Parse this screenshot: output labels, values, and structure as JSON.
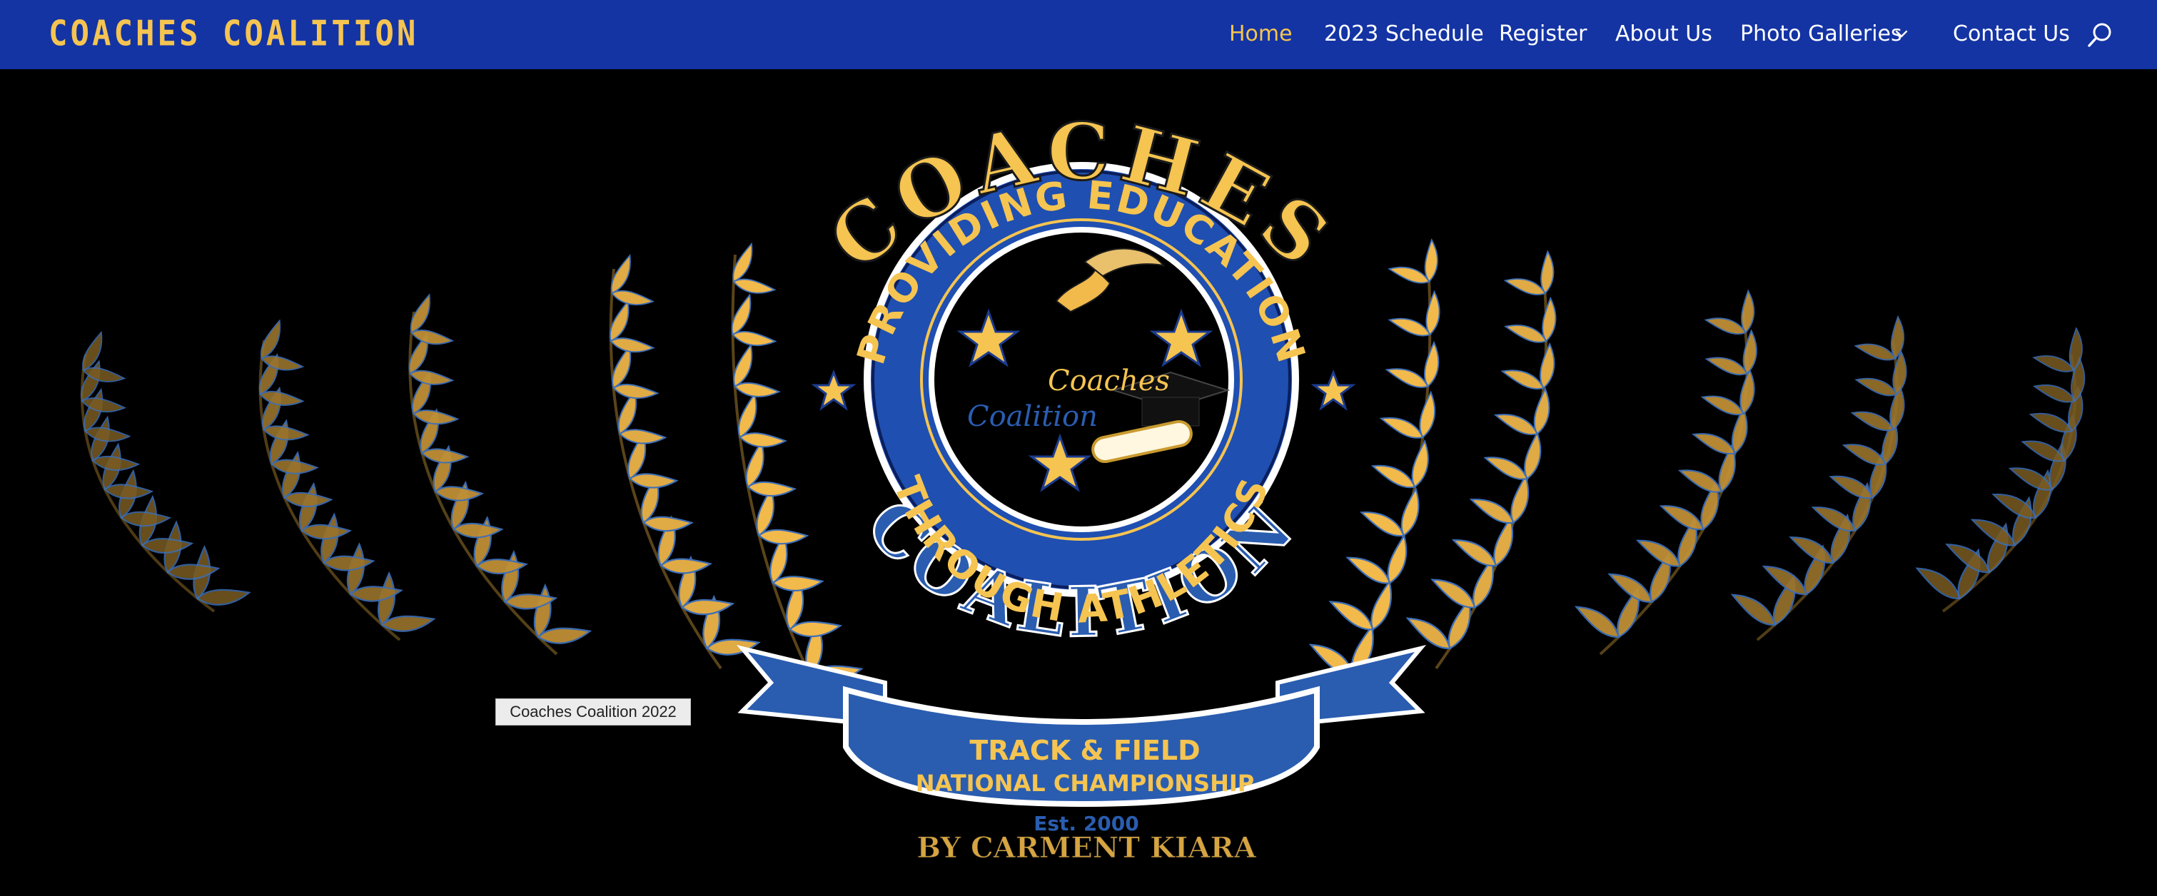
{
  "header": {
    "brand": "COACHES COALITION",
    "nav": [
      {
        "label": "Home",
        "active": true
      },
      {
        "label": "2023 Schedule"
      },
      {
        "label": "Register"
      },
      {
        "label": "About Us"
      },
      {
        "label": "Photo Galleries",
        "has_dropdown": true
      },
      {
        "label": "Contact Us"
      }
    ],
    "search_icon": "search-icon"
  },
  "emblem": {
    "arc_top": "COACHES",
    "arc_bottom": "COALITION",
    "ring_top": "PROVIDING EDUCATION",
    "ring_bottom": "THROUGH ATHLETICS",
    "center_line1": "Coaches",
    "center_line2": "Coalition",
    "banner_line1": "TRACK & FIELD",
    "banner_line2": "NATIONAL CHAMPIONSHIP",
    "est": "Est. 2000",
    "credit": "BY CARMENT KIARA"
  },
  "tooltip": "Coaches Coalition 2022",
  "colors": {
    "nav_bg": "#1434a4",
    "brand_gold": "#f5c451",
    "royal_blue": "#2a5db0",
    "laurel_gold": "#f2b94b"
  }
}
